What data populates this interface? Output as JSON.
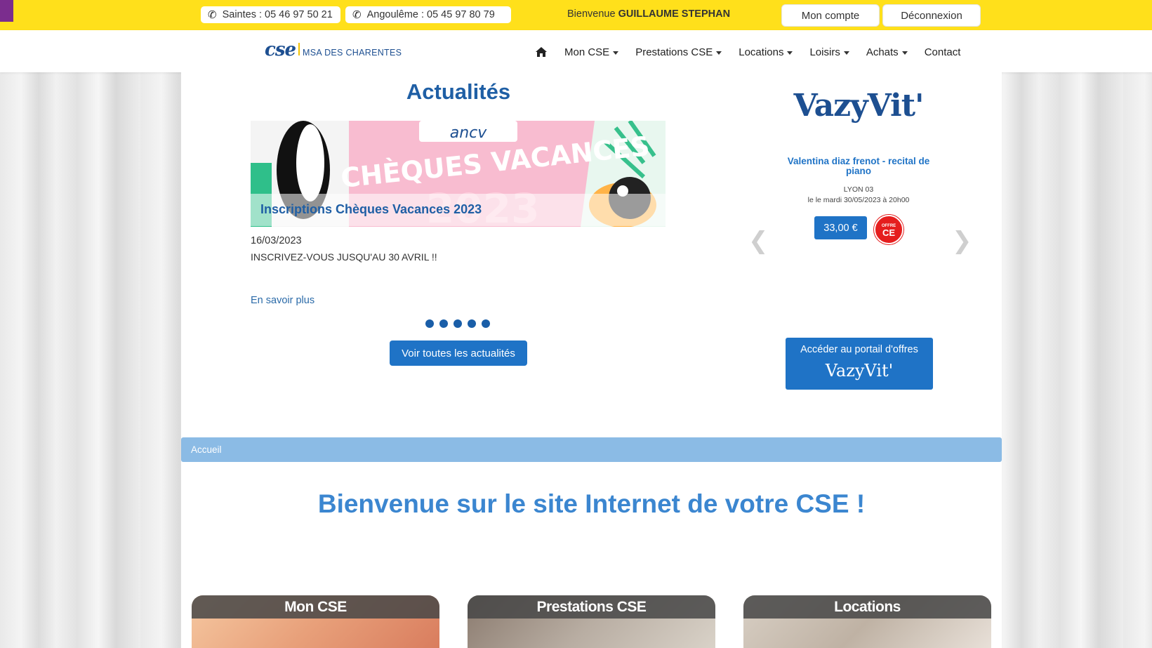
{
  "topbar": {
    "phone_saintes": "Saintes : 05 46 97 50 21",
    "phone_angouleme": "Angoulême : 05 45 97 80 79",
    "welcome_prefix": "Bienvenue",
    "user_name": "GUILLAUME STEPHAN",
    "account_label": "Mon compte",
    "logout_label": "Déconnexion"
  },
  "logo": {
    "mark": "cse",
    "text": "MSA DES CHARENTES"
  },
  "nav": {
    "items": [
      {
        "label": "Mon CSE"
      },
      {
        "label": "Prestations CSE"
      },
      {
        "label": "Locations"
      },
      {
        "label": "Loisirs"
      },
      {
        "label": "Achats"
      },
      {
        "label": "Contact"
      }
    ]
  },
  "news": {
    "heading": "Actualités",
    "banner_brand": "ancv",
    "banner_title": "CHÈQUES VACANCES",
    "banner_year": "2023",
    "caption": "Inscriptions Chèques Vacances 2023",
    "date": "16/03/2023",
    "text": "INSCRIVEZ-VOUS JUSQU'AU 30 AVRIL !!",
    "more": "En savoir plus",
    "dots": 5,
    "all_button": "Voir toutes les actualités"
  },
  "vazyvit": {
    "logo": "VazyVit'",
    "event_title": "Valentina diaz frenot - recital de piano",
    "event_city": "LYON 03",
    "event_date": "le le mardi 30/05/2023 à 20h00",
    "price": "33,00 €",
    "badge_top": "OFFRE",
    "badge_bottom": "CE",
    "portal_line1": "Accéder au portail d'offres",
    "portal_line2": "VazyVit'"
  },
  "breadcrumb": {
    "current": "Accueil"
  },
  "welcome": {
    "title": "Bienvenue sur le site Internet de votre CSE !"
  },
  "cards": [
    {
      "label": "Mon CSE"
    },
    {
      "label": "Prestations CSE"
    },
    {
      "label": "Locations"
    }
  ],
  "colors": {
    "topbar": "#ffe01b",
    "primary": "#1f73c6",
    "breadcrumb": "#8bbbe5",
    "brand_dark": "#1d4f91"
  },
  "icons": [
    "phone-icon",
    "home-icon",
    "chevron-left-icon",
    "chevron-right-icon"
  ]
}
